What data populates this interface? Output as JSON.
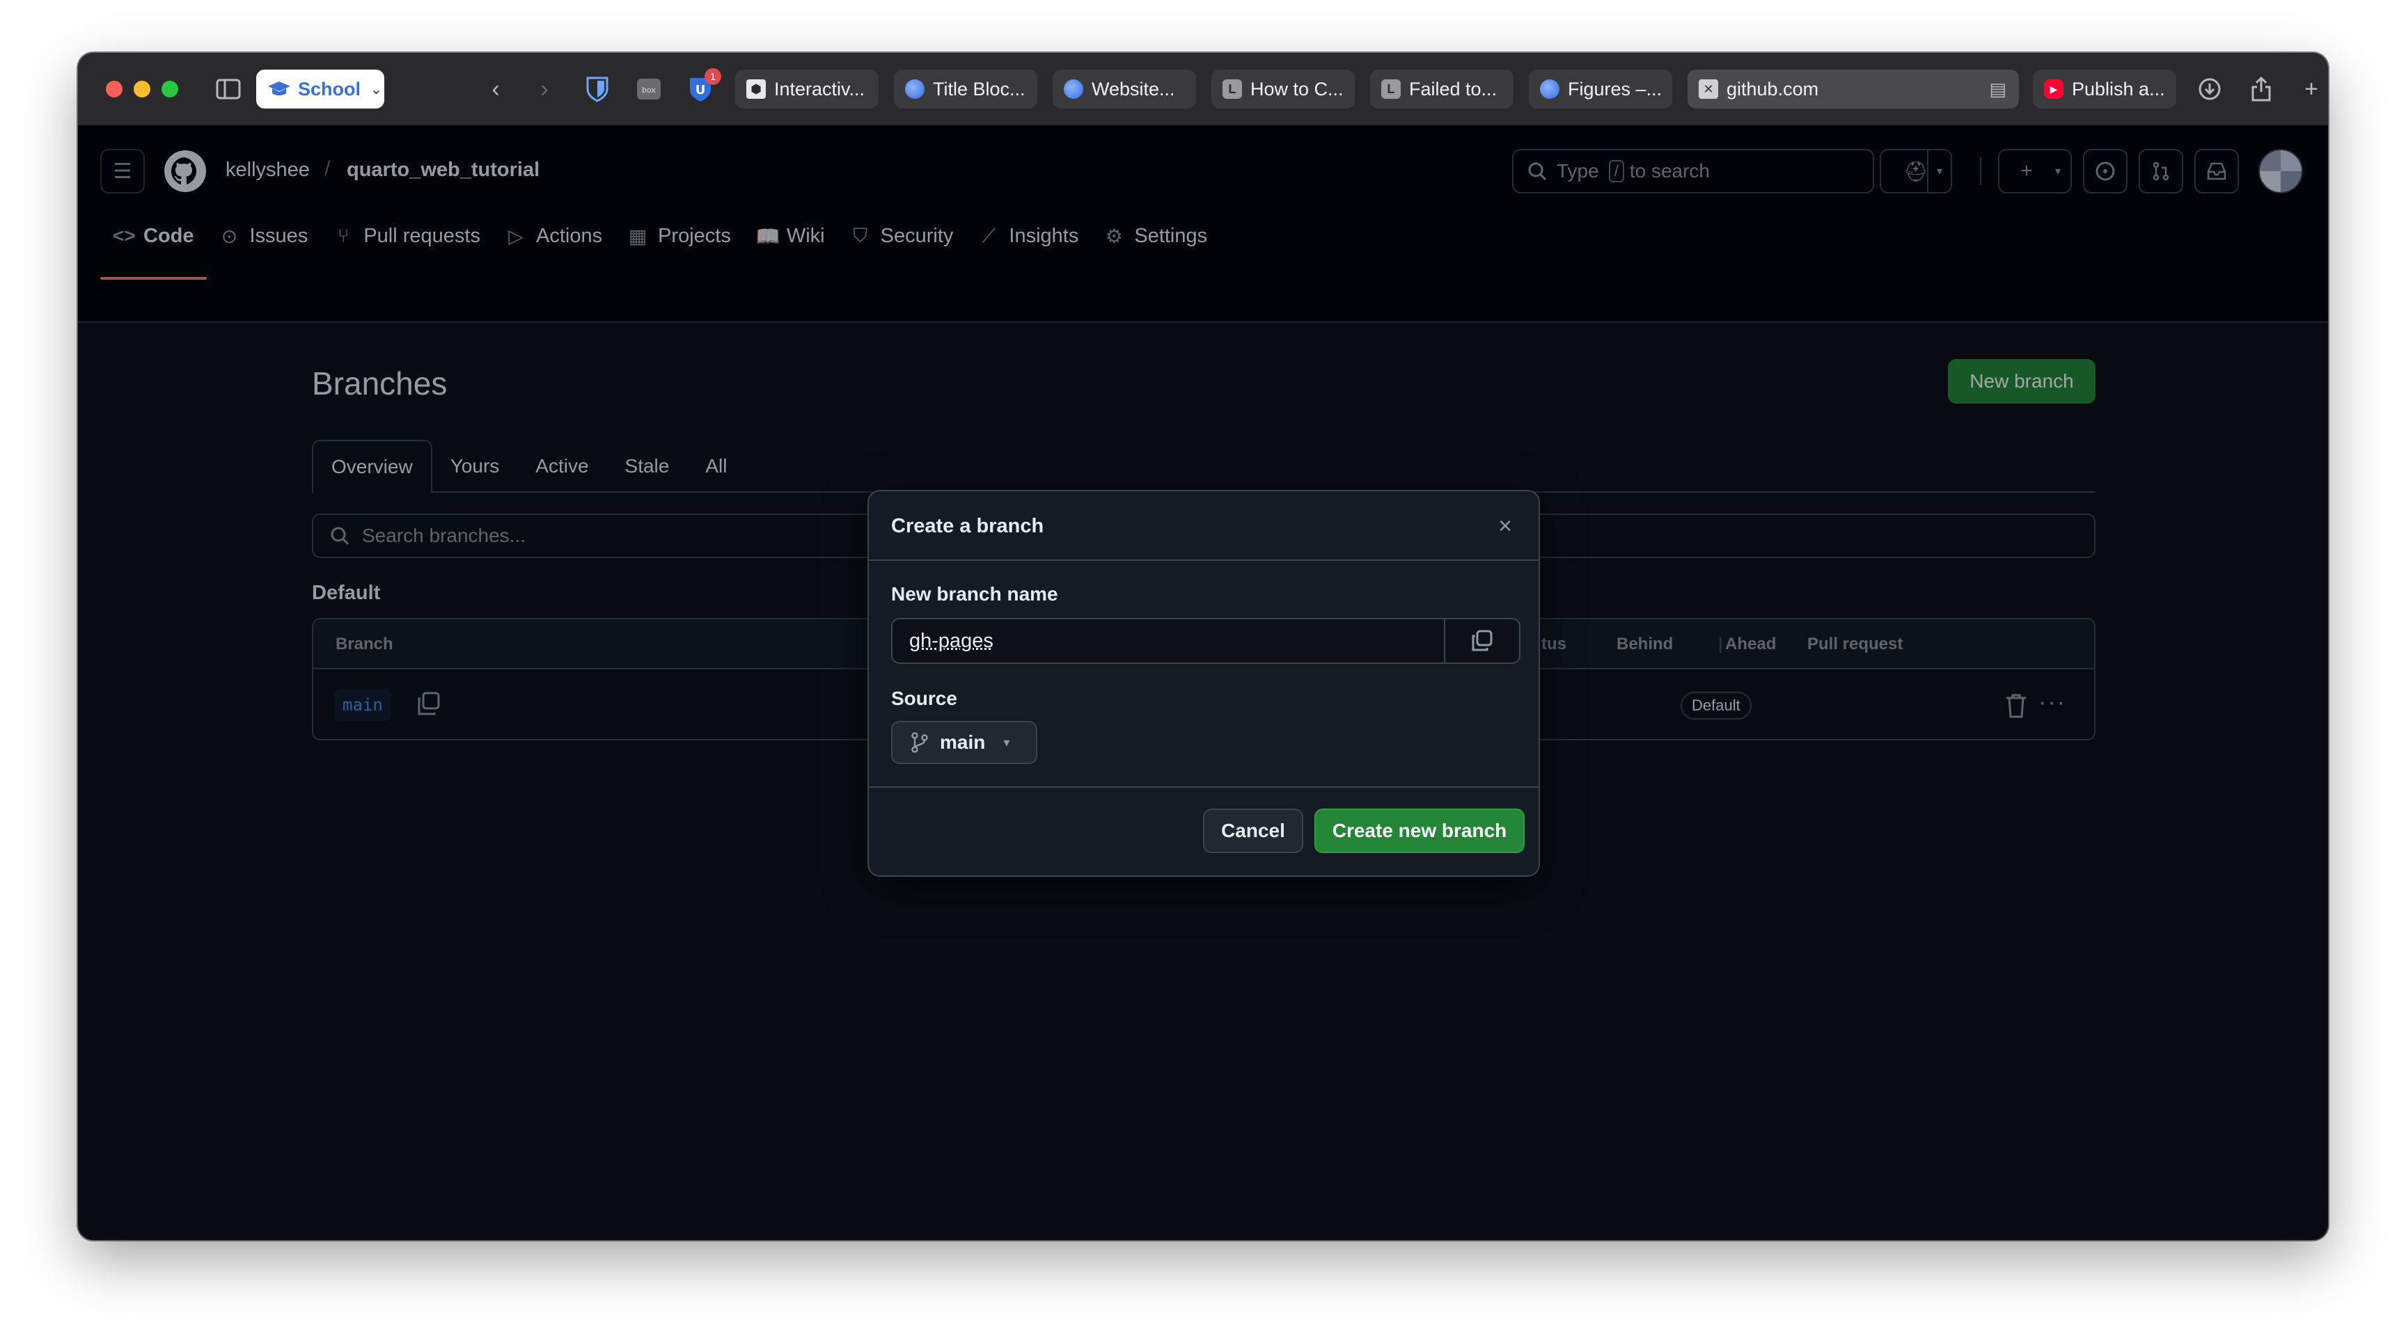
{
  "browser": {
    "profile_label": "School",
    "tabs": [
      {
        "label": "Interactiv...",
        "icon": "hexagon-favicon"
      },
      {
        "label": "Title Bloc...",
        "icon": "globe-favicon"
      },
      {
        "label": "Website...",
        "icon": "globe-favicon"
      },
      {
        "label": "How to C...",
        "icon": "l-favicon",
        "glyph": "L"
      },
      {
        "label": "Failed to...",
        "icon": "l-favicon",
        "glyph": "L"
      },
      {
        "label": "Figures –...",
        "icon": "globe-favicon"
      },
      {
        "label": "github.com",
        "icon": "close-favicon",
        "active": true
      },
      {
        "label": "Publish a...",
        "icon": "youtube-favicon"
      }
    ],
    "notification_badge": "1"
  },
  "header": {
    "owner": "kellyshee",
    "separator": "/",
    "repo": "quarto_web_tutorial",
    "search_placeholder_pre": "Type",
    "search_key": "/",
    "search_placeholder_post": "to search"
  },
  "repo_nav": [
    {
      "label": "Code",
      "icon": "code-icon",
      "active": true
    },
    {
      "label": "Issues",
      "icon": "issue-icon"
    },
    {
      "label": "Pull requests",
      "icon": "pull-request-icon"
    },
    {
      "label": "Actions",
      "icon": "play-icon"
    },
    {
      "label": "Projects",
      "icon": "table-icon"
    },
    {
      "label": "Wiki",
      "icon": "book-icon"
    },
    {
      "label": "Security",
      "icon": "shield-icon"
    },
    {
      "label": "Insights",
      "icon": "graph-icon"
    },
    {
      "label": "Settings",
      "icon": "gear-icon"
    }
  ],
  "page": {
    "title": "Branches",
    "new_branch_label": "New branch",
    "subtabs": [
      "Overview",
      "Yours",
      "Active",
      "Stale",
      "All"
    ],
    "search_placeholder": "Search branches...",
    "section_label": "Default",
    "table_headers": {
      "branch": "Branch",
      "status_partial": "tus",
      "behind": "Behind",
      "ahead": "Ahead",
      "pull_request": "Pull request"
    },
    "rows": [
      {
        "name": "main",
        "badge": "Default"
      }
    ]
  },
  "dialog": {
    "title": "Create a branch",
    "name_label": "New branch name",
    "name_value": "gh-pages",
    "source_label": "Source",
    "source_value": "main",
    "cancel_label": "Cancel",
    "create_label": "Create new branch"
  },
  "colors": {
    "accent_green": "#238636",
    "link_blue": "#4493f8",
    "active_tab_underline": "#f78166",
    "background": "#0d1117"
  }
}
